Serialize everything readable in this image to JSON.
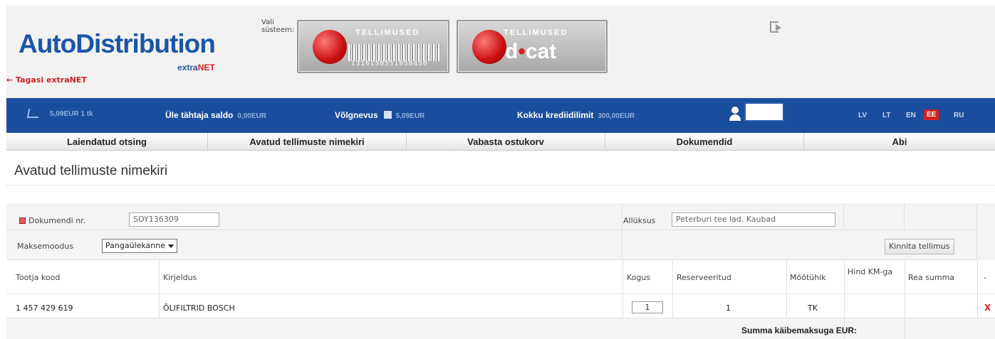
{
  "header": {
    "logo_text": "AutoDistribution",
    "logo_sub_prefix": "extra",
    "logo_sub_suffix": "NET",
    "back_link": "← Tagasi extraNET",
    "system_label": "Vali süsteem:",
    "system_buttons": [
      {
        "caption": "TELLIMUSED",
        "barcode_number": "1316158551958456"
      },
      {
        "caption": "TELLIMUSED",
        "brand_prefix": "d",
        "brand_dot": "•",
        "brand_suffix": "cat"
      }
    ]
  },
  "bluebar": {
    "cart_value": "5,09EUR  1 tk",
    "overdue_label": "Üle tähtaja saldo",
    "overdue_value": "0,00EUR",
    "debt_label": "Võlgnevus",
    "debt_value": "5,09EUR",
    "credit_label": "Kokku krediidilimit",
    "credit_value": "300,00EUR",
    "languages": [
      "LV",
      "LT",
      "EN",
      "EE",
      "RU"
    ],
    "active_language": "EE"
  },
  "tabs": [
    "Laiendatud otsing",
    "Avatud tellimuste nimekiri",
    "Vabasta ostukorv",
    "Dokumendid",
    "Abi"
  ],
  "page_title": "Avatud tellimuste nimekiri",
  "form": {
    "doc_number_label": "Dokumendi nr.",
    "doc_number_value": "SOY136309",
    "branch_label": "Allüksus",
    "branch_value": "Peterburi tee lad. Kaubad",
    "payment_label": "Maksemoodus",
    "payment_value": "Pangaülekanne",
    "confirm_button": "Kinnita tellimus"
  },
  "table": {
    "columns": [
      "Tootja kood",
      "Kirjeldus",
      "Kogus",
      "Reserveeritud",
      "Mõõtühik",
      "Hind KM-ga",
      "Rea summa",
      "-"
    ],
    "rows": [
      {
        "code": "1 457 429 619",
        "description": "ÕLIFILTRID BOSCH",
        "quantity": "1",
        "reserved": "1",
        "unit": "TK",
        "price": "",
        "row_sum": "",
        "delete": "X"
      }
    ],
    "total_label": "Summa käibemaksuga EUR:"
  }
}
